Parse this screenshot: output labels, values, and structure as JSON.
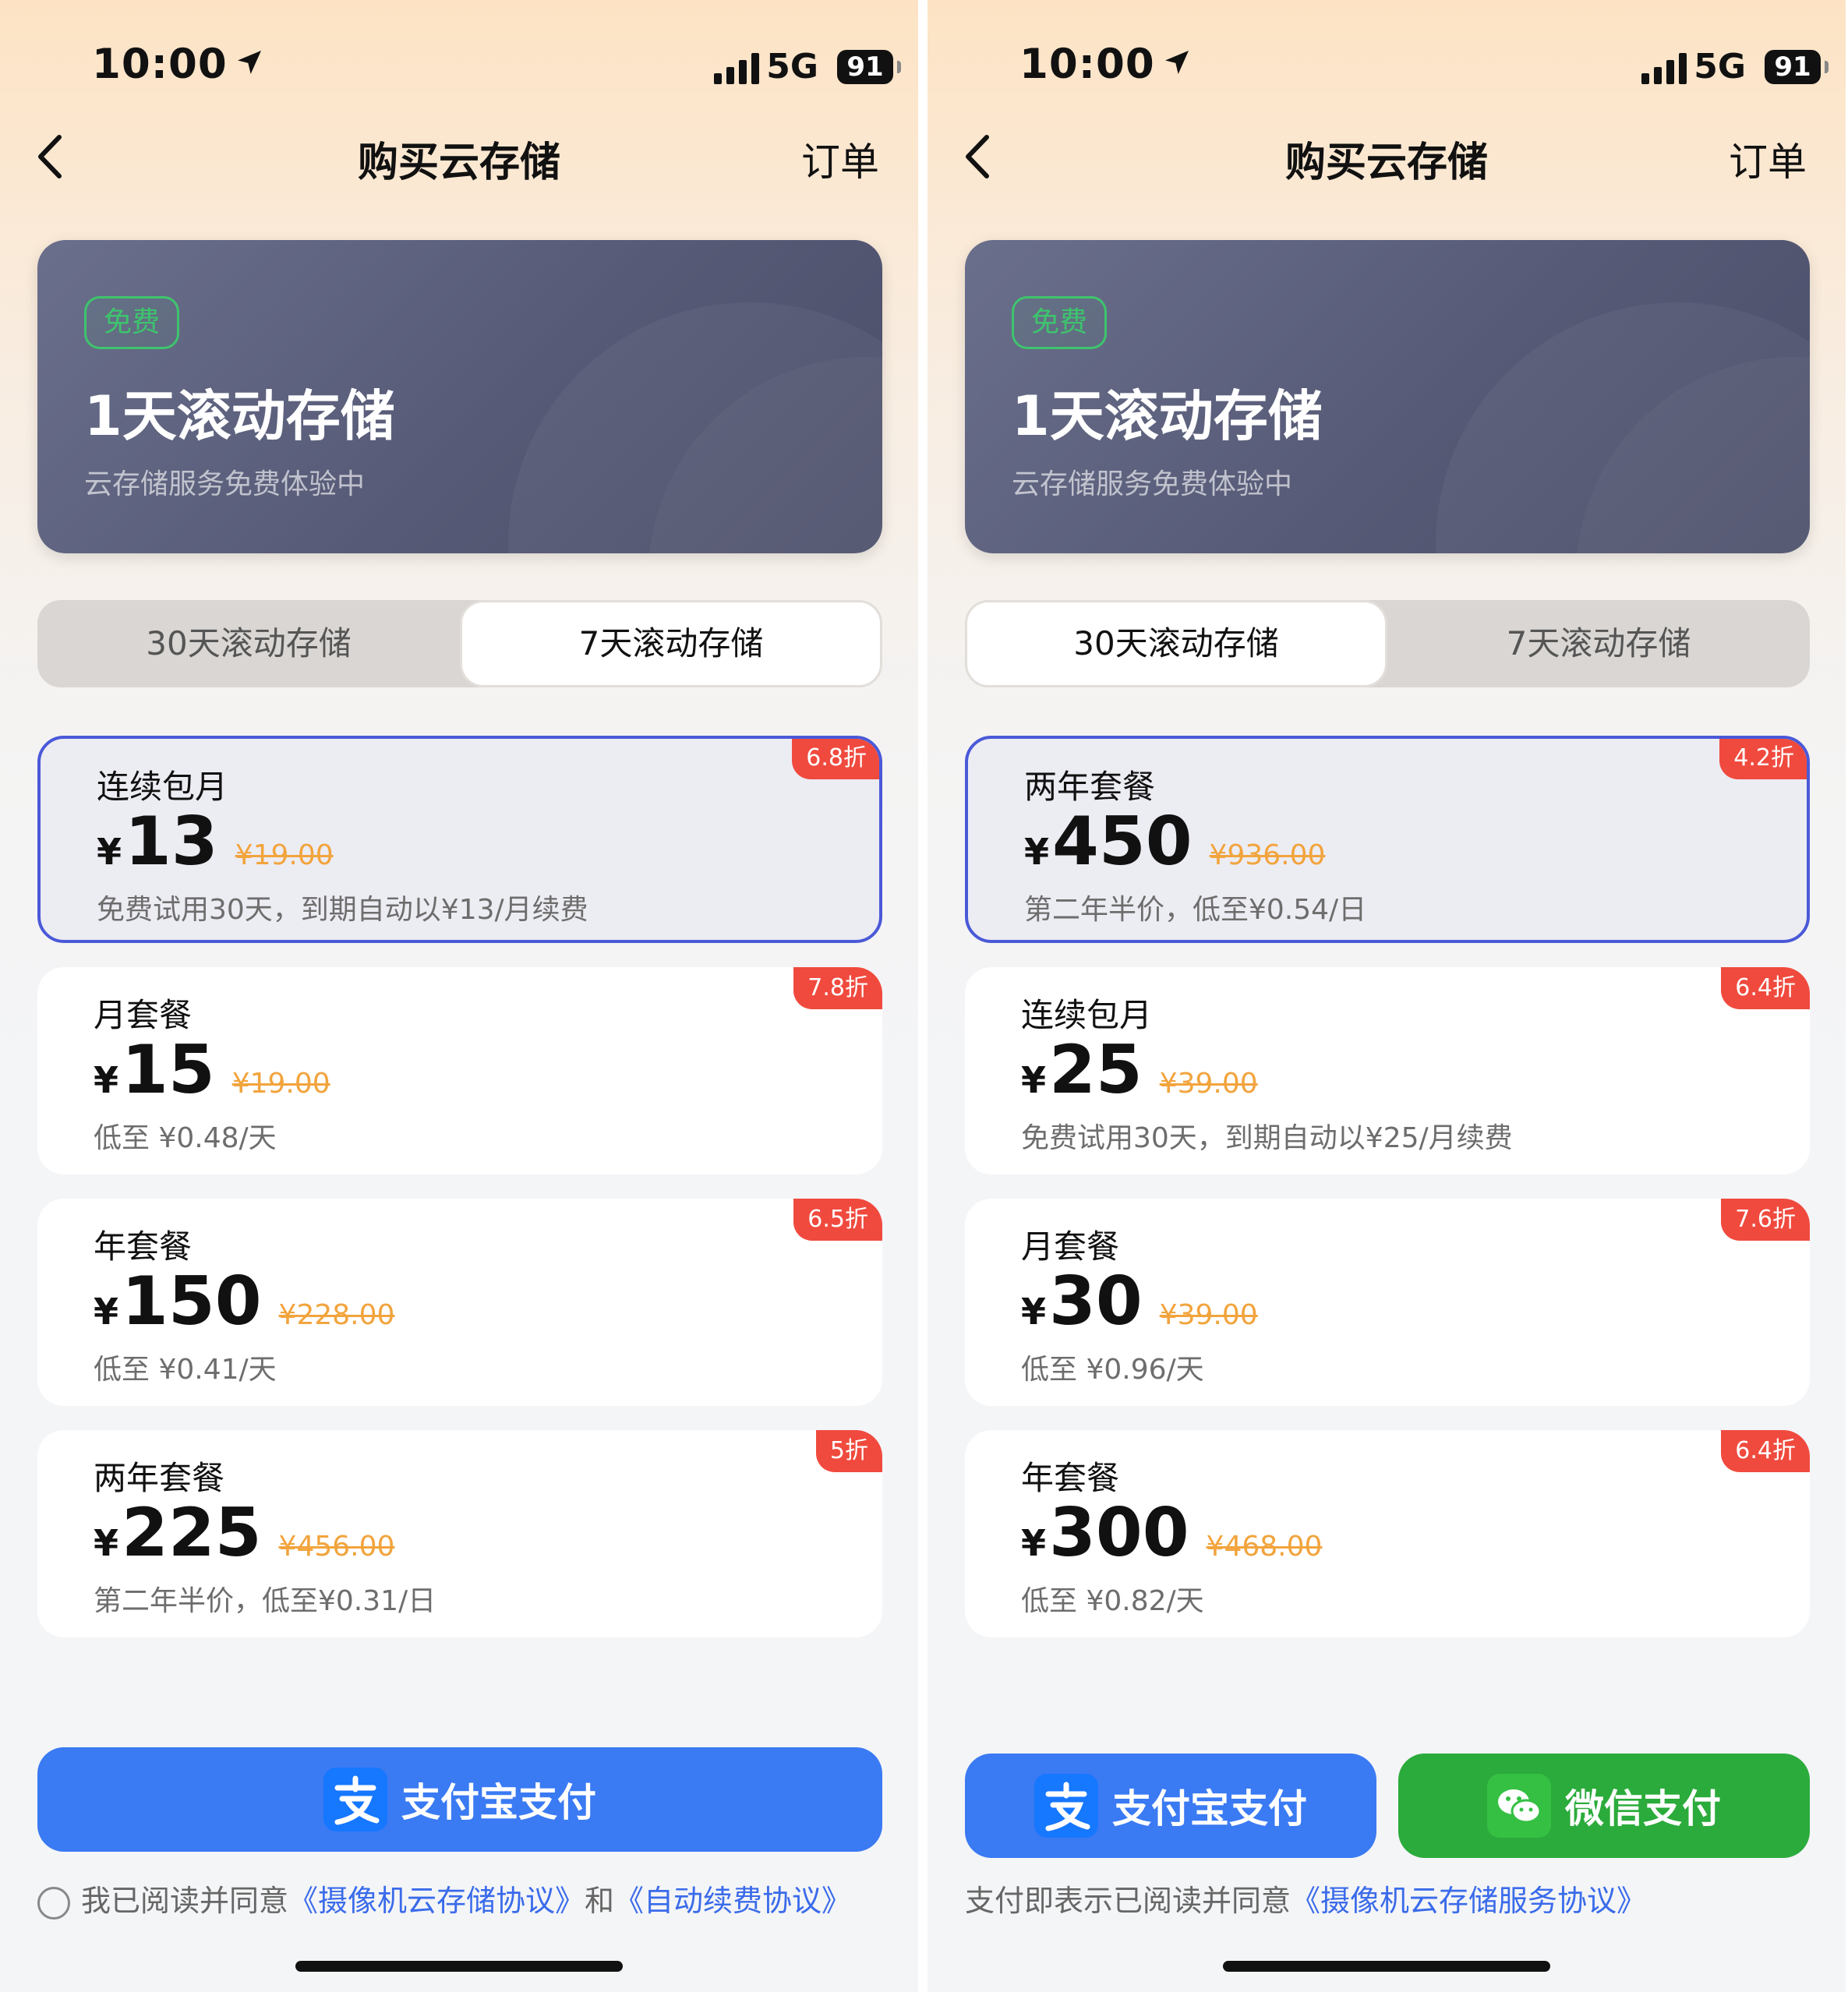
{
  "left": {
    "status": {
      "time": "10:00",
      "network": "5G",
      "battery": "91"
    },
    "nav": {
      "title": "购买云存储",
      "right_label": "订单"
    },
    "hero": {
      "badge": "免费",
      "title": "1天滚动存储",
      "subtitle": "云存储服务免费体验中"
    },
    "tabs": [
      {
        "label": "30天滚动存储",
        "active": false
      },
      {
        "label": "7天滚动存储",
        "active": true
      }
    ],
    "plans": [
      {
        "name": "连续包月",
        "currency": "¥",
        "price": "13",
        "original": "¥19.00",
        "desc": "免费试用30天，到期自动以¥13/月续费",
        "discount": "6.8折",
        "selected": true
      },
      {
        "name": "月套餐",
        "currency": "¥",
        "price": "15",
        "original": "¥19.00",
        "desc": "低至 ¥0.48/天",
        "discount": "7.8折",
        "selected": false
      },
      {
        "name": "年套餐",
        "currency": "¥",
        "price": "150",
        "original": "¥228.00",
        "desc": "低至 ¥0.41/天",
        "discount": "6.5折",
        "selected": false
      },
      {
        "name": "两年套餐",
        "currency": "¥",
        "price": "225",
        "original": "¥456.00",
        "desc": "第二年半价，低至¥0.31/日",
        "discount": "5折",
        "selected": false
      }
    ],
    "pay": {
      "alipay_label": "支付宝支付"
    },
    "agreement": {
      "prefix": "我已阅读并同意",
      "link1": "《摄像机云存储协议》",
      "middle": "和",
      "link2": "《自动续费协议》"
    }
  },
  "right": {
    "status": {
      "time": "10:00",
      "network": "5G",
      "battery": "91"
    },
    "nav": {
      "title": "购买云存储",
      "right_label": "订单"
    },
    "hero": {
      "badge": "免费",
      "title": "1天滚动存储",
      "subtitle": "云存储服务免费体验中"
    },
    "tabs": [
      {
        "label": "30天滚动存储",
        "active": true
      },
      {
        "label": "7天滚动存储",
        "active": false
      }
    ],
    "plans": [
      {
        "name": "两年套餐",
        "currency": "¥",
        "price": "450",
        "original": "¥936.00",
        "desc": "第二年半价，低至¥0.54/日",
        "discount": "4.2折",
        "selected": true
      },
      {
        "name": "连续包月",
        "currency": "¥",
        "price": "25",
        "original": "¥39.00",
        "desc": "免费试用30天，到期自动以¥25/月续费",
        "discount": "6.4折",
        "selected": false
      },
      {
        "name": "月套餐",
        "currency": "¥",
        "price": "30",
        "original": "¥39.00",
        "desc": "低至 ¥0.96/天",
        "discount": "7.6折",
        "selected": false
      },
      {
        "name": "年套餐",
        "currency": "¥",
        "price": "300",
        "original": "¥468.00",
        "desc": "低至 ¥0.82/天",
        "discount": "6.4折",
        "selected": false
      }
    ],
    "pay": {
      "alipay_label": "支付宝支付",
      "wechat_label": "微信支付"
    },
    "agreement": {
      "prefix": "支付即表示已阅读并同意",
      "link1": "《摄像机云存储服务协议》"
    }
  },
  "colors": {
    "accent_blue": "#3a7af3",
    "wechat_green": "#2bab3b",
    "discount_red": "#f04a3e",
    "original_price_orange": "#f2a43d",
    "selected_border": "#4a59d8",
    "free_badge_green": "#3ec46d"
  },
  "icons": [
    "back-chevron-icon",
    "location-arrow-icon",
    "signal-bars-icon",
    "alipay-icon",
    "wechat-icon",
    "checkbox-icon"
  ]
}
